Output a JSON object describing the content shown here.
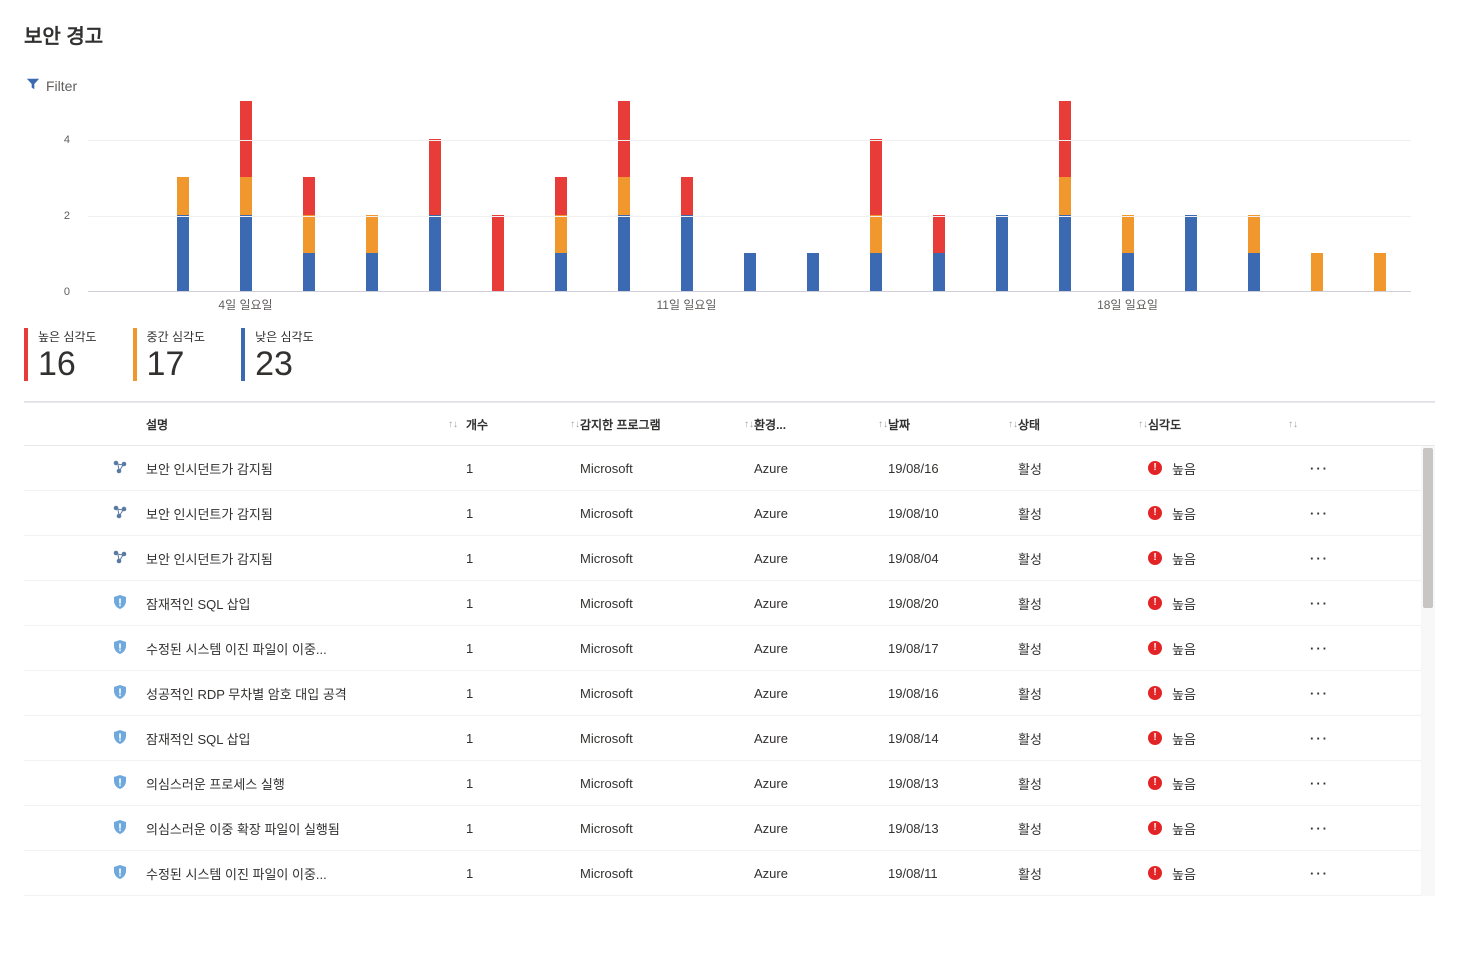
{
  "page_title": "보안 경고",
  "filter_label": "Filter",
  "chart_data": {
    "type": "bar",
    "stack_mode": "stacked",
    "ylabel": "",
    "ylim": [
      0,
      5
    ],
    "yticks": [
      0,
      2,
      4
    ],
    "categories_count": 20,
    "xaxis_labels": [
      {
        "index": 2,
        "label": "4일 일요일"
      },
      {
        "index": 9,
        "label": "11일 일요일"
      },
      {
        "index": 16,
        "label": "18일 일요일"
      }
    ],
    "series": [
      {
        "name": "낮은 심각도",
        "color": "#3b6ab3",
        "values": [
          0,
          2,
          2,
          1,
          1,
          2,
          0,
          1,
          2,
          2,
          1,
          1,
          1,
          1,
          2,
          2,
          1,
          2,
          1,
          0,
          0
        ]
      },
      {
        "name": "중간 심각도",
        "color": "#f0972e",
        "values": [
          0,
          1,
          1,
          1,
          1,
          0,
          0,
          1,
          1,
          0,
          0,
          0,
          1,
          0,
          0,
          1,
          1,
          0,
          1,
          1,
          1
        ]
      },
      {
        "name": "높은 심각도",
        "color": "#e73c37",
        "values": [
          0,
          0,
          2,
          1,
          0,
          2,
          2,
          1,
          2,
          1,
          0,
          0,
          2,
          1,
          0,
          2,
          0,
          0,
          0,
          0,
          0
        ]
      }
    ]
  },
  "summary": [
    {
      "label": "높은 심각도",
      "value": "16",
      "color": "#e73c37"
    },
    {
      "label": "중간 심각도",
      "value": "17",
      "color": "#f0972e"
    },
    {
      "label": "낮은 심각도",
      "value": "23",
      "color": "#3b6ab3"
    }
  ],
  "table": {
    "columns": [
      "설명",
      "개수",
      "감지한 프로그램",
      "환경...",
      "날짜",
      "상태",
      "심각도"
    ],
    "rows": [
      {
        "icon": "incident",
        "desc": "보안 인시던트가 감지됨",
        "count": "1",
        "detected": "Microsoft",
        "env": "Azure",
        "date": "19/08/16",
        "status": "활성",
        "severity": "높음"
      },
      {
        "icon": "incident",
        "desc": "보안 인시던트가 감지됨",
        "count": "1",
        "detected": "Microsoft",
        "env": "Azure",
        "date": "19/08/10",
        "status": "활성",
        "severity": "높음"
      },
      {
        "icon": "incident",
        "desc": "보안 인시던트가 감지됨",
        "count": "1",
        "detected": "Microsoft",
        "env": "Azure",
        "date": "19/08/04",
        "status": "활성",
        "severity": "높음"
      },
      {
        "icon": "shield",
        "desc": "잠재적인 SQL 삽입",
        "count": "1",
        "detected": "Microsoft",
        "env": "Azure",
        "date": "19/08/20",
        "status": "활성",
        "severity": "높음"
      },
      {
        "icon": "shield",
        "desc": "수정된 시스템 이진 파일이 이중...",
        "count": "1",
        "detected": "Microsoft",
        "env": "Azure",
        "date": "19/08/17",
        "status": "활성",
        "severity": "높음"
      },
      {
        "icon": "shield",
        "desc": "성공적인 RDP 무차별 암호 대입 공격",
        "count": "1",
        "detected": "Microsoft",
        "env": "Azure",
        "date": "19/08/16",
        "status": "활성",
        "severity": "높음"
      },
      {
        "icon": "shield",
        "desc": "잠재적인 SQL 삽입",
        "count": "1",
        "detected": "Microsoft",
        "env": "Azure",
        "date": "19/08/14",
        "status": "활성",
        "severity": "높음"
      },
      {
        "icon": "shield",
        "desc": "의심스러운 프로세스 실행",
        "count": "1",
        "detected": "Microsoft",
        "env": "Azure",
        "date": "19/08/13",
        "status": "활성",
        "severity": "높음"
      },
      {
        "icon": "shield",
        "desc": "의심스러운 이중 확장 파일이 실행됨",
        "count": "1",
        "detected": "Microsoft",
        "env": "Azure",
        "date": "19/08/13",
        "status": "활성",
        "severity": "높음"
      },
      {
        "icon": "shield",
        "desc": "수정된 시스템 이진 파일이 이중...",
        "count": "1",
        "detected": "Microsoft",
        "env": "Azure",
        "date": "19/08/11",
        "status": "활성",
        "severity": "높음"
      }
    ]
  },
  "more_glyph": "···"
}
